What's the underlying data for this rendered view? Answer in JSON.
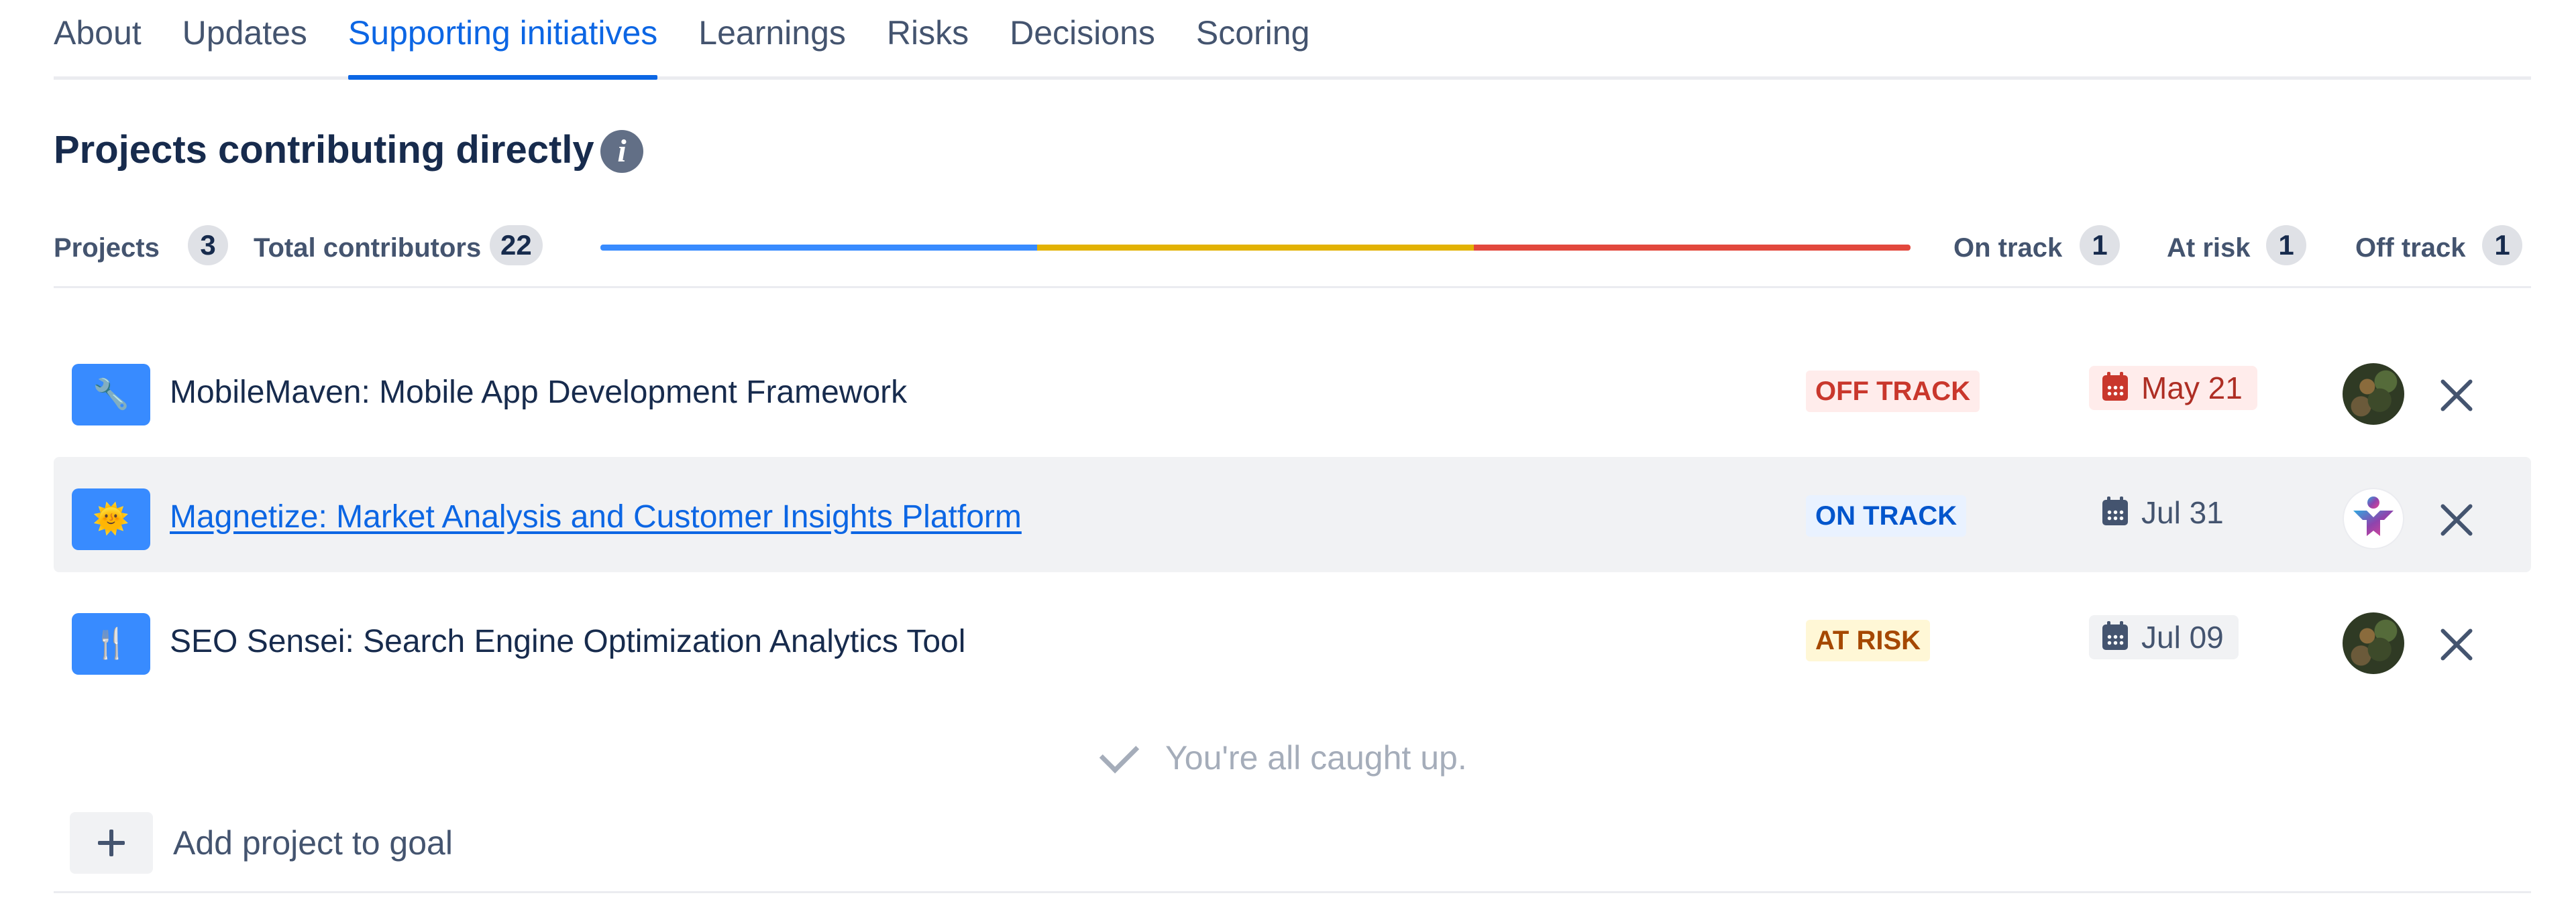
{
  "tabs": [
    {
      "label": "About",
      "active": false
    },
    {
      "label": "Updates",
      "active": false
    },
    {
      "label": "Supporting initiatives",
      "active": true
    },
    {
      "label": "Learnings",
      "active": false
    },
    {
      "label": "Risks",
      "active": false
    },
    {
      "label": "Decisions",
      "active": false
    },
    {
      "label": "Scoring",
      "active": false
    }
  ],
  "section": {
    "title": "Projects contributing directly",
    "info_icon": "info-icon"
  },
  "summary": {
    "projects_label": "Projects",
    "projects_count": "3",
    "contributors_label": "Total contributors",
    "contributors_count": "22",
    "on_track_label": "On track",
    "on_track_count": "1",
    "at_risk_label": "At risk",
    "at_risk_count": "1",
    "off_track_label": "Off track",
    "off_track_count": "1",
    "progress_fractions": {
      "on_track": 0.3333,
      "at_risk": 0.3333,
      "off_track": 0.3334
    },
    "colors": {
      "on_track": "#388BFF",
      "at_risk": "#E2B203",
      "off_track": "#E2483D"
    }
  },
  "projects": [
    {
      "name": "MobileMaven: Mobile App Development Framework",
      "icon": "wrench-emoji",
      "icon_glyph": "🔧",
      "status": "OFF TRACK",
      "due_date": "May 21",
      "is_link": false,
      "owner_avatar": "photo-avatar"
    },
    {
      "name": "Magnetize: Market Analysis and Customer Insights Platform",
      "icon": "sun-emoji",
      "icon_glyph": "🌞",
      "status": "ON TRACK",
      "due_date": "Jul 31",
      "is_link": true,
      "owner_avatar": "team-logo-avatar"
    },
    {
      "name": "SEO Sensei: Search Engine Optimization Analytics Tool",
      "icon": "fork-knife-emoji",
      "icon_glyph": "🍴",
      "status": "AT RISK",
      "due_date": "Jul 09",
      "is_link": false,
      "owner_avatar": "photo-avatar"
    }
  ],
  "caught_up_text": "You're all caught up.",
  "add_project_label": "Add project to goal"
}
